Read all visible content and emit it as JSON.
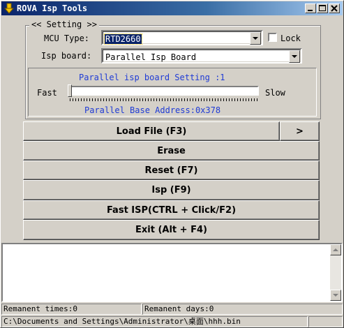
{
  "window": {
    "title": "ROVA Isp Tools",
    "icon": "download-arrow-icon"
  },
  "setting": {
    "group_label": "<< Setting  >>",
    "mcu_label": "MCU Type:",
    "mcu_value": "RTD2660",
    "lock_label": "Lock",
    "lock_checked": false,
    "isp_board_label": "Isp board:",
    "isp_board_value": "Parallel Isp Board"
  },
  "parallel": {
    "title": "Parallel isp board Setting :1",
    "fast_label": "Fast",
    "slow_label": "Slow",
    "speed_level": 0,
    "base_address": "Parallel Base Address:0x378",
    "text_color": "#1f3bd6"
  },
  "buttons": {
    "load_file": "Load File (F3)",
    "load_more": ">",
    "erase": "Erase",
    "reset": "Reset (F7)",
    "isp": "Isp (F9)",
    "fast_isp": "Fast ISP(CTRL + Click/F2)",
    "exit": "Exit (Alt + F4)"
  },
  "status": {
    "remanent_times": "Remanent times:0",
    "remanent_days": "Remanent days:0",
    "file_path": "C:\\Documents and Settings\\Administrator\\桌面\\hhh.bin"
  },
  "colors": {
    "titlebar_start": "#0a246a",
    "titlebar_end": "#a6caf0",
    "face": "#d4d0c8"
  }
}
